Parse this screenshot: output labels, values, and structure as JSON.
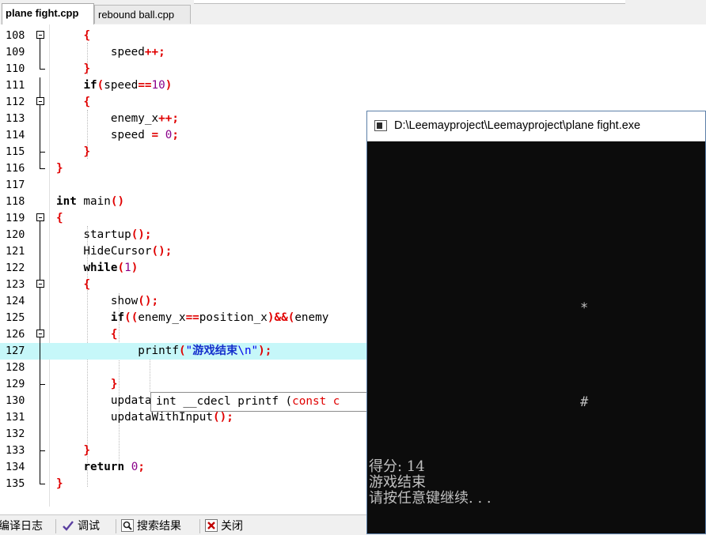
{
  "tabs": [
    "plane fight.cpp",
    "rebound ball.cpp"
  ],
  "code": {
    "line_numbers": [
      "108",
      "109",
      "110",
      "111",
      "112",
      "113",
      "114",
      "115",
      "116",
      "117",
      "118",
      "119",
      "120",
      "121",
      "122",
      "123",
      "124",
      "125",
      "126",
      "127",
      "128",
      "129",
      "130",
      "131",
      "132",
      "133",
      "134",
      "135"
    ],
    "tooltip_parts": [
      "int __cdecl printf (",
      "const c"
    ]
  },
  "bottom_tabs": [
    "编译日志",
    "调试",
    "搜索结果",
    "关闭"
  ],
  "console": {
    "title": "D:\\Leemayproject\\Leemayproject\\plane fight.exe",
    "enemy_glyph": "*",
    "plane_glyph": "#",
    "lines": [
      "得分: 14",
      "游戏结束",
      "请按任意键继续. . ."
    ]
  },
  "colors": {
    "keyword": "#000000",
    "operator": "#e00000",
    "number": "#8a008a",
    "string": "#0000ee",
    "highlight_line": "#c6f7f9",
    "console_bg": "#0c0c0c",
    "console_text": "#c0c0c0"
  },
  "icons": {
    "compile_log": "compile-log-icon",
    "debug": "checkmark-icon",
    "search": "magnifier-icon",
    "close": "close-icon",
    "console": "console-window-icon"
  }
}
